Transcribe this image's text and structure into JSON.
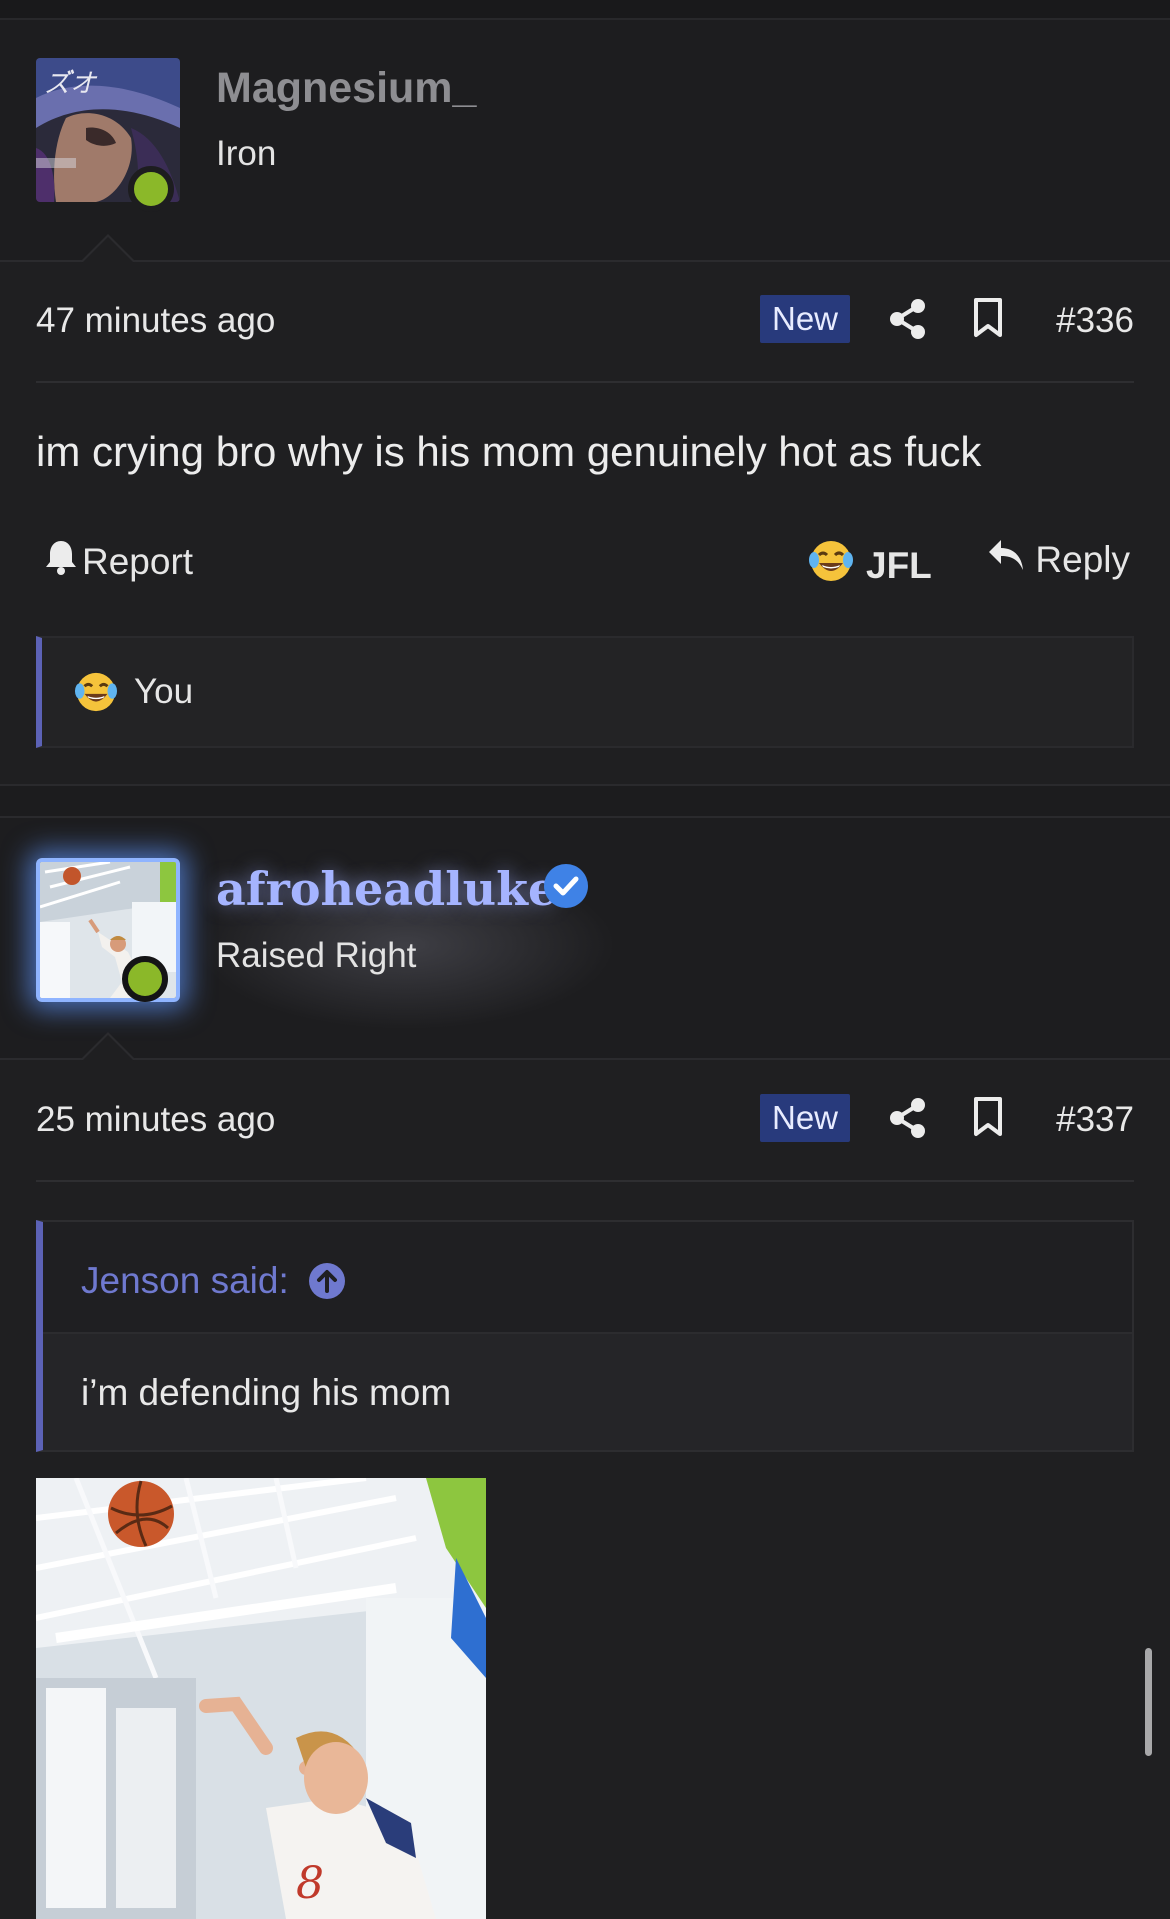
{
  "posts": [
    {
      "username": "Magnesium_",
      "user_title": "Iron",
      "timestamp": "47 minutes ago",
      "badge": "New",
      "post_number": "#336",
      "message": "im crying bro why is his mom genuinely hot as fuck",
      "actions": {
        "report": "Report",
        "reaction": "JFL",
        "reply": "Reply"
      },
      "reactions": {
        "reactor": "You"
      }
    },
    {
      "username": "afroheadluke",
      "user_title": "Raised Right",
      "timestamp": "25 minutes ago",
      "badge": "New",
      "post_number": "#337",
      "quote": {
        "author": "Jenson said:",
        "text": "i’m defending his mom"
      }
    }
  ],
  "colors": {
    "background": "#1f1f21",
    "accent_quote": "#5c62b6",
    "badge_new": "#283a7c",
    "online": "#8bb829",
    "verified": "#3f82e6",
    "fancy_name": "#a5b4ff"
  },
  "icons": [
    "share-icon",
    "bookmark-icon",
    "bell-icon",
    "laughing-crying-emoji",
    "reply-arrow-icon",
    "verified-check-icon",
    "arrow-up-circle-icon"
  ]
}
